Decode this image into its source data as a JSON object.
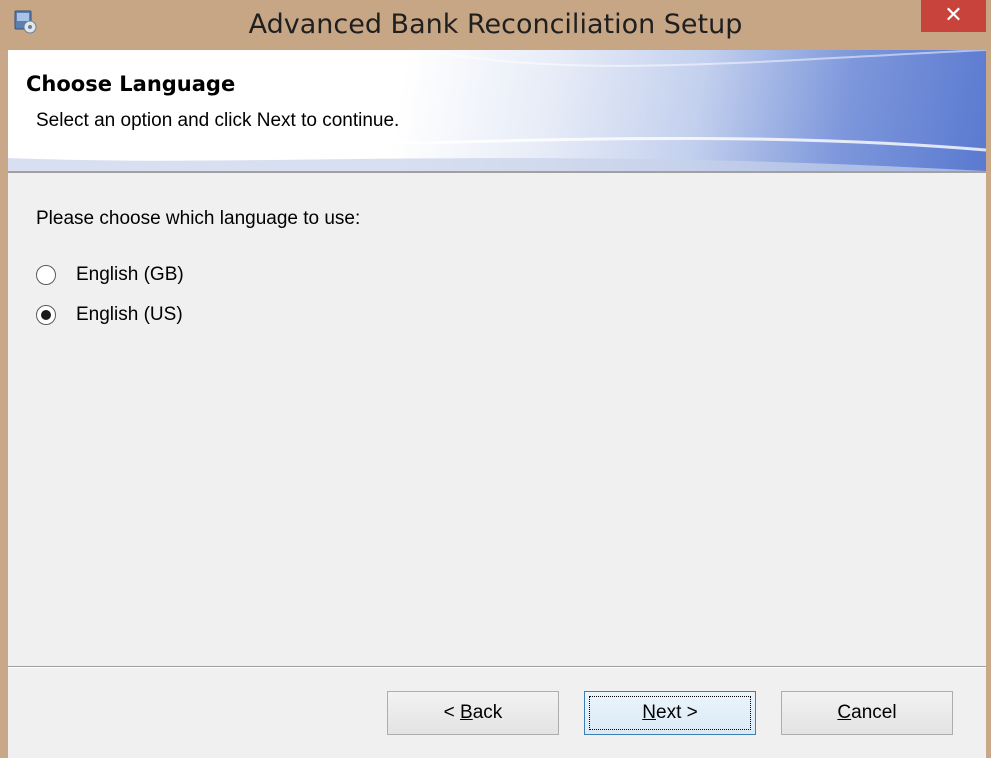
{
  "window": {
    "title": "Advanced Bank Reconciliation Setup",
    "close_glyph": "✕",
    "app_icon": "setup-installer-icon"
  },
  "header": {
    "title": "Choose Language",
    "subtitle": "Select an option and click Next to continue."
  },
  "main": {
    "prompt": "Please choose which language to use:",
    "options": [
      {
        "label": "English (GB)",
        "selected": false
      },
      {
        "label": "English (US)",
        "selected": true
      }
    ]
  },
  "buttons": {
    "back": {
      "prefix": "< ",
      "mnemonic": "B",
      "rest": "ack"
    },
    "next": {
      "mnemonic": "N",
      "rest": "ext >"
    },
    "cancel": {
      "mnemonic": "C",
      "rest": "ancel"
    }
  },
  "colors": {
    "close_button": "#c7433b",
    "title_bar": "#c7a686",
    "banner_accent": "#5a79d0",
    "default_button_border": "#3c7fb1"
  }
}
